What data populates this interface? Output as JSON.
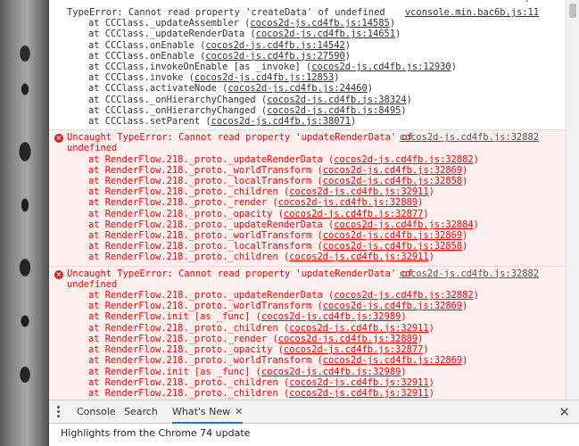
{
  "console": {
    "top_cut_text": "vconsole.min.bac6b.js:11",
    "messages": [
      {
        "type": "plain",
        "text": "TypeError: Cannot read property 'createData' of undefined",
        "source": "vconsole.min.bac6b.js:11",
        "frames": [
          {
            "fn": "at CCClass._updateAssembler (",
            "loc": "cocos2d-js.cd4fb.js:14585",
            "end": ")"
          },
          {
            "fn": "at CCClass._updateRenderData (",
            "loc": "cocos2d-js.cd4fb.js:14651",
            "end": ")"
          },
          {
            "fn": "at CCClass.onEnable (",
            "loc": "cocos2d-js.cd4fb.js:14542",
            "end": ")"
          },
          {
            "fn": "at CCClass.onEnable (",
            "loc": "cocos2d-js.cd4fb.js:27590",
            "end": ")"
          },
          {
            "fn": "at CCClass.invokeOnEnable [as _invoke] (",
            "loc": "cocos2d-js.cd4fb.js:12930",
            "end": ")"
          },
          {
            "fn": "at CCClass.invoke (",
            "loc": "cocos2d-js.cd4fb.js:12853",
            "end": ")"
          },
          {
            "fn": "at CCClass.activateNode (",
            "loc": "cocos2d-js.cd4fb.js:24460",
            "end": ")"
          },
          {
            "fn": "at CCClass._onHierarchyChanged (",
            "loc": "cocos2d-js.cd4fb.js:38324",
            "end": ")"
          },
          {
            "fn": "at CCClass._onHierarchyChanged (",
            "loc": "cocos2d-js.cd4fb.js:8495",
            "end": ")"
          },
          {
            "fn": "at CCClass.setParent (",
            "loc": "cocos2d-js.cd4fb.js:38071",
            "end": ")"
          }
        ]
      },
      {
        "type": "error",
        "text": "Uncaught TypeError: Cannot read property 'updateRenderData' of",
        "text2": "undefined",
        "source": "cocos2d-js.cd4fb.js:32882",
        "frames": [
          {
            "fn": "at RenderFlow.218._proto._updateRenderData (",
            "loc": "cocos2d-js.cd4fb.js:32882",
            "end": ")"
          },
          {
            "fn": "at RenderFlow.218._proto._worldTransform (",
            "loc": "cocos2d-js.cd4fb.js:32869",
            "end": ")"
          },
          {
            "fn": "at RenderFlow.218._proto._localTransform (",
            "loc": "cocos2d-js.cd4fb.js:32858",
            "end": ")"
          },
          {
            "fn": "at RenderFlow.218._proto._children (",
            "loc": "cocos2d-js.cd4fb.js:32911",
            "end": ")"
          },
          {
            "fn": "at RenderFlow.218._proto._render (",
            "loc": "cocos2d-js.cd4fb.js:32889",
            "end": ")"
          },
          {
            "fn": "at RenderFlow.218._proto._opacity (",
            "loc": "cocos2d-js.cd4fb.js:32877",
            "end": ")"
          },
          {
            "fn": "at RenderFlow.218._proto._updateRenderData (",
            "loc": "cocos2d-js.cd4fb.js:32884",
            "end": ")"
          },
          {
            "fn": "at RenderFlow.218._proto._worldTransform (",
            "loc": "cocos2d-js.cd4fb.js:32869",
            "end": ")"
          },
          {
            "fn": "at RenderFlow.218._proto._localTransform (",
            "loc": "cocos2d-js.cd4fb.js:32858",
            "end": ")"
          },
          {
            "fn": "at RenderFlow.218._proto._children (",
            "loc": "cocos2d-js.cd4fb.js:32911",
            "end": ")"
          }
        ]
      },
      {
        "type": "error",
        "text": "Uncaught TypeError: Cannot read property 'updateRenderData' of",
        "text2": "undefined",
        "source": "cocos2d-js.cd4fb.js:32882",
        "frames": [
          {
            "fn": "at RenderFlow.218._proto._updateRenderData (",
            "loc": "cocos2d-js.cd4fb.js:32882",
            "end": ")"
          },
          {
            "fn": "at RenderFlow.218._proto._worldTransform (",
            "loc": "cocos2d-js.cd4fb.js:32869",
            "end": ")"
          },
          {
            "fn": "at RenderFlow.init [as _func] (",
            "loc": "cocos2d-js.cd4fb.js:32989",
            "end": ")"
          },
          {
            "fn": "at RenderFlow.218._proto._children (",
            "loc": "cocos2d-js.cd4fb.js:32911",
            "end": ")"
          },
          {
            "fn": "at RenderFlow.218._proto._render (",
            "loc": "cocos2d-js.cd4fb.js:32889",
            "end": ")"
          },
          {
            "fn": "at RenderFlow.218._proto._opacity (",
            "loc": "cocos2d-js.cd4fb.js:32877",
            "end": ")"
          },
          {
            "fn": "at RenderFlow.218._proto._worldTransform (",
            "loc": "cocos2d-js.cd4fb.js:32869",
            "end": ")"
          },
          {
            "fn": "at RenderFlow.init [as _func] (",
            "loc": "cocos2d-js.cd4fb.js:32989",
            "end": ")"
          },
          {
            "fn": "at RenderFlow.218._proto._children (",
            "loc": "cocos2d-js.cd4fb.js:32911",
            "end": ")"
          },
          {
            "fn": "at RenderFlow.218._proto._children (",
            "loc": "cocos2d-js.cd4fb.js:32911",
            "end": ")"
          }
        ]
      }
    ]
  },
  "drawer": {
    "tabs": [
      {
        "label": "Console",
        "active": false
      },
      {
        "label": "Search",
        "active": false
      },
      {
        "label": "What's New",
        "active": true
      }
    ],
    "tab_close_glyph": "✕",
    "close_glyph": "✕",
    "body_text": "Highlights from the Chrome 74 update"
  },
  "colors": {
    "error_text": "#ff0000",
    "error_bg": "#fff0f0",
    "active_tab_accent": "#1a73e8"
  }
}
